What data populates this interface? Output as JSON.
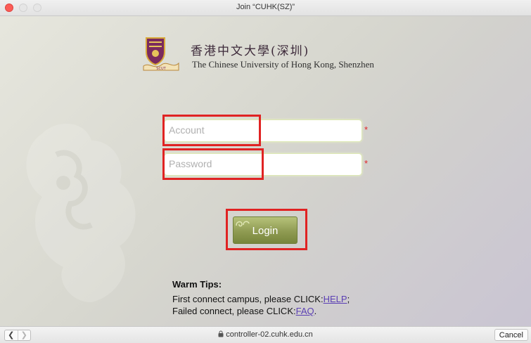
{
  "window": {
    "title": "Join “CUHK(SZ)”"
  },
  "brand": {
    "name_cn": "香港中文大學(深圳)",
    "name_en": "The Chinese University of Hong Kong, Shenzhen"
  },
  "form": {
    "account_placeholder": "Account",
    "password_placeholder": "Password",
    "required_marker": "*",
    "login_label": "Login"
  },
  "tips": {
    "title": "Warm Tips:",
    "line1_text": "First connect campus, please CLICK:",
    "line1_link": "HELP",
    "line1_suffix": ";",
    "line2_text": "Failed connect, please CLICK:",
    "line2_link": "FAQ",
    "line2_suffix": "."
  },
  "bottombar": {
    "back_icon": "chevron-left-icon",
    "forward_icon": "chevron-right-icon",
    "url": "controller-02.cuhk.edu.cn",
    "cancel_label": "Cancel"
  },
  "colors": {
    "annotation": "#e02323",
    "link": "#5b3fb4",
    "button": "#8f9b52",
    "required": "#e2272a"
  }
}
